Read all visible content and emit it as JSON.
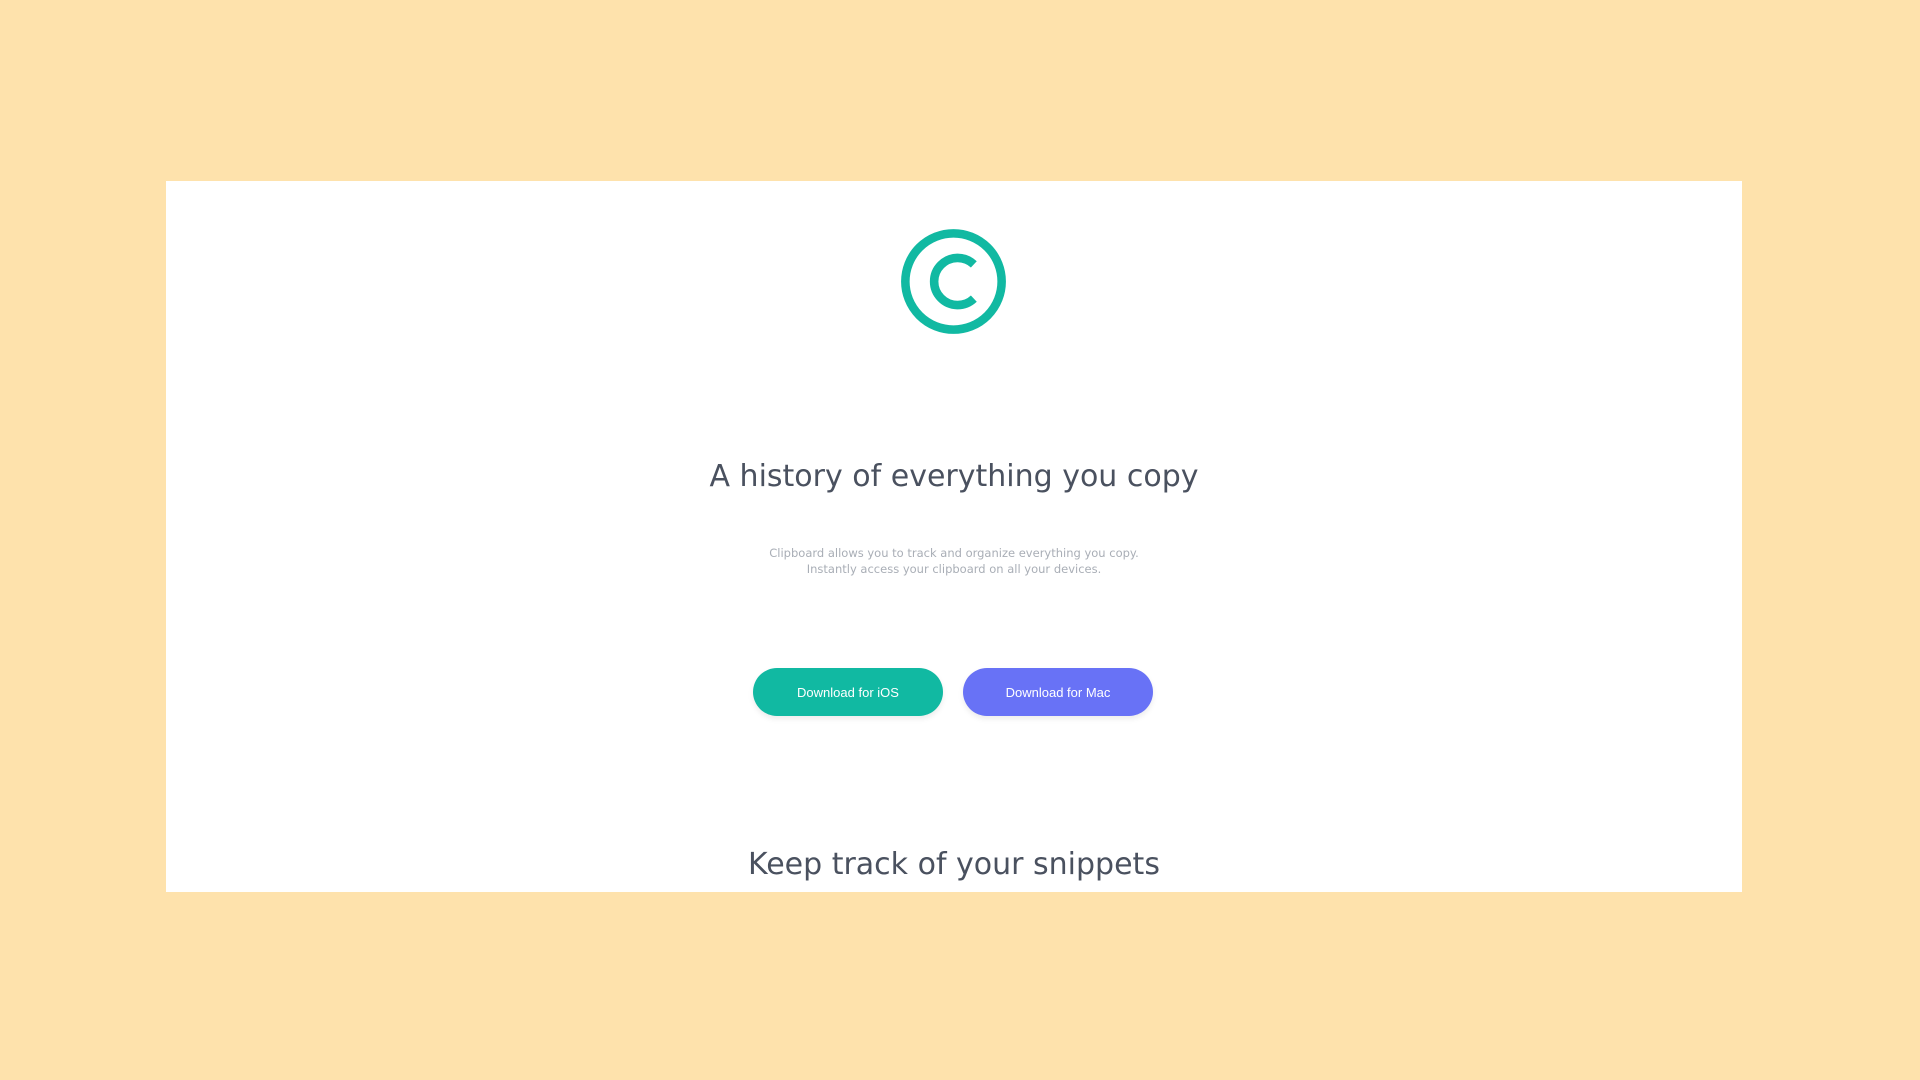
{
  "hero": {
    "logo_icon": "copyright-circle-icon",
    "title": "A history of everything you copy",
    "description": "Clipboard allows you to track and organize everything you copy. Instantly access your clipboard on all your devices."
  },
  "buttons": {
    "ios_label": "Download for iOS",
    "mac_label": "Download for Mac"
  },
  "section": {
    "title": "Keep track of your snippets"
  },
  "colors": {
    "background": "#fee2ac",
    "accent_teal": "#11b9a2",
    "accent_indigo": "#6872f6",
    "heading": "#4a515f",
    "body_text": "#a9aeb6"
  }
}
